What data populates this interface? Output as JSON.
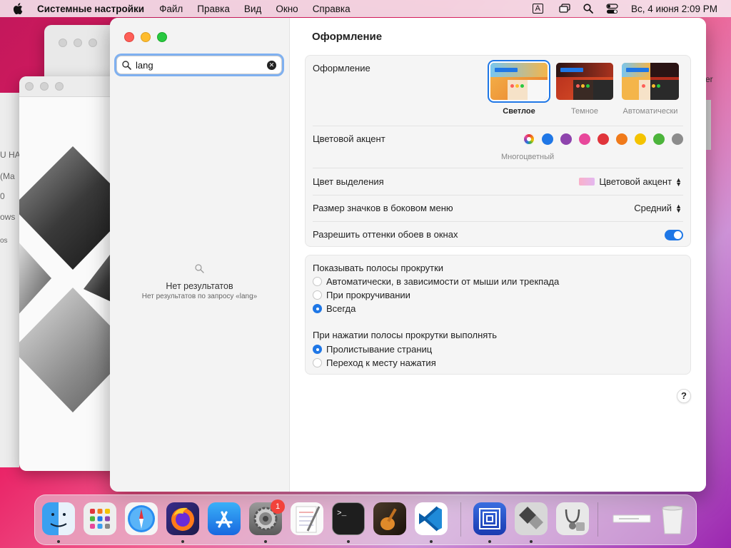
{
  "menubar": {
    "app_name": "Системные настройки",
    "items": [
      "Файл",
      "Правка",
      "Вид",
      "Окно",
      "Справка"
    ],
    "keyboard_indicator": "A",
    "clock": "Вс, 4 июня  2:09 PM"
  },
  "background": {
    "left_texts": [
      "U HA",
      "(Ma",
      "0",
      "ows",
      "os"
    ],
    "right_text": "er"
  },
  "sidebar": {
    "search_value": "lang",
    "no_results_title": "Нет результатов",
    "no_results_sub": "Нет результатов по запросу «lang»"
  },
  "content": {
    "title": "Оформление",
    "appearance": {
      "label": "Оформление",
      "options": [
        {
          "label": "Светлое",
          "selected": true
        },
        {
          "label": "Темное",
          "selected": false
        },
        {
          "label": "Автоматически",
          "selected": false
        }
      ]
    },
    "accent": {
      "label": "Цветовой акцент",
      "selected_caption": "Многоцветный",
      "colors": [
        "multicolor",
        "#1f77e6",
        "#8e44ad",
        "#e8489b",
        "#e0343b",
        "#f07a1a",
        "#f4c300",
        "#4cb43b",
        "#8c8c8c"
      ]
    },
    "highlight": {
      "label": "Цвет выделения",
      "value": "Цветовой акцент"
    },
    "sidebar_icon_size": {
      "label": "Размер значков в боковом меню",
      "value": "Средний"
    },
    "wallpaper_tint": {
      "label": "Разрешить оттенки обоев в окнах",
      "enabled": true
    },
    "scrollbars": {
      "label": "Показывать полосы прокрутки",
      "options": [
        {
          "label": "Автоматически, в зависимости от мыши или трекпада",
          "selected": false
        },
        {
          "label": "При прокручивании",
          "selected": false
        },
        {
          "label": "Всегда",
          "selected": true
        }
      ]
    },
    "scroll_click": {
      "label": "При нажатии полосы прокрутки выполнять",
      "options": [
        {
          "label": "Пролистывание страниц",
          "selected": true
        },
        {
          "label": "Переход к месту нажатия",
          "selected": false
        }
      ]
    },
    "help_label": "?"
  },
  "dock": {
    "apps": [
      "finder",
      "launchpad",
      "safari",
      "firefox",
      "app-store",
      "system-settings",
      "textedit",
      "terminal",
      "garageband",
      "vscode",
      "parallels",
      "bootcamp-assistant",
      "disk-utility",
      "document",
      "trash"
    ],
    "system_settings_badge": "1"
  }
}
